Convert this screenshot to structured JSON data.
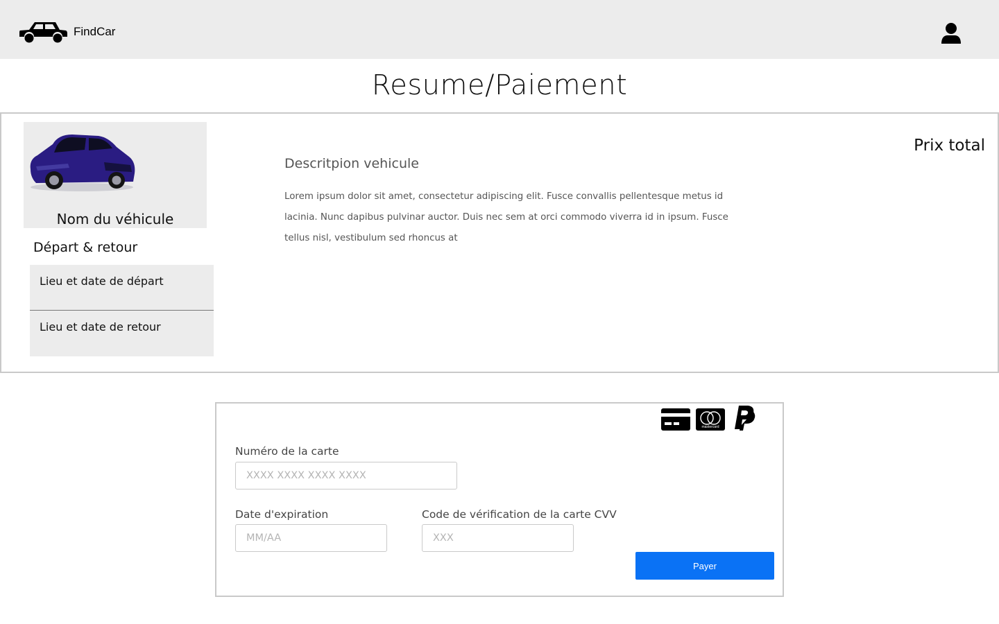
{
  "header": {
    "brand": "FindCar",
    "logo_icon": "car-icon",
    "user_icon": "user-icon",
    "background": "#ececec"
  },
  "page": {
    "title": "Resume/Paiement"
  },
  "summary": {
    "vehicle_name": "Nom du véhicule",
    "depart_retour_title": "Départ & retour",
    "depart_label": "Lieu et date de départ",
    "retour_label": "Lieu et date de retour",
    "description_title": "Descritpion vehicule",
    "description_text": "Lorem ipsum dolor sit amet, consectetur adipiscing elit. Fusce convallis pellentesque metus id lacinia. Nunc dapibus pulvinar auctor. Duis nec sem at orci commodo viverra id in ipsum. Fusce tellus nisl, vestibulum sed rhoncus at",
    "total_label": "Prix total"
  },
  "payment": {
    "icons": [
      "credit-card-icon",
      "mastercard-icon",
      "paypal-icon"
    ],
    "mastercard_text": "mastercard",
    "card_number_label": "Numéro de la carte",
    "card_number_placeholder": "XXXX XXXX XXXX XXXX",
    "expiry_label": "Date d'expiration",
    "expiry_placeholder": "MM/AA",
    "cvv_label": "Code de vérification de la carte CVV",
    "cvv_placeholder": "XXX",
    "pay_button": "Payer",
    "accent_color": "#0a72f5"
  }
}
